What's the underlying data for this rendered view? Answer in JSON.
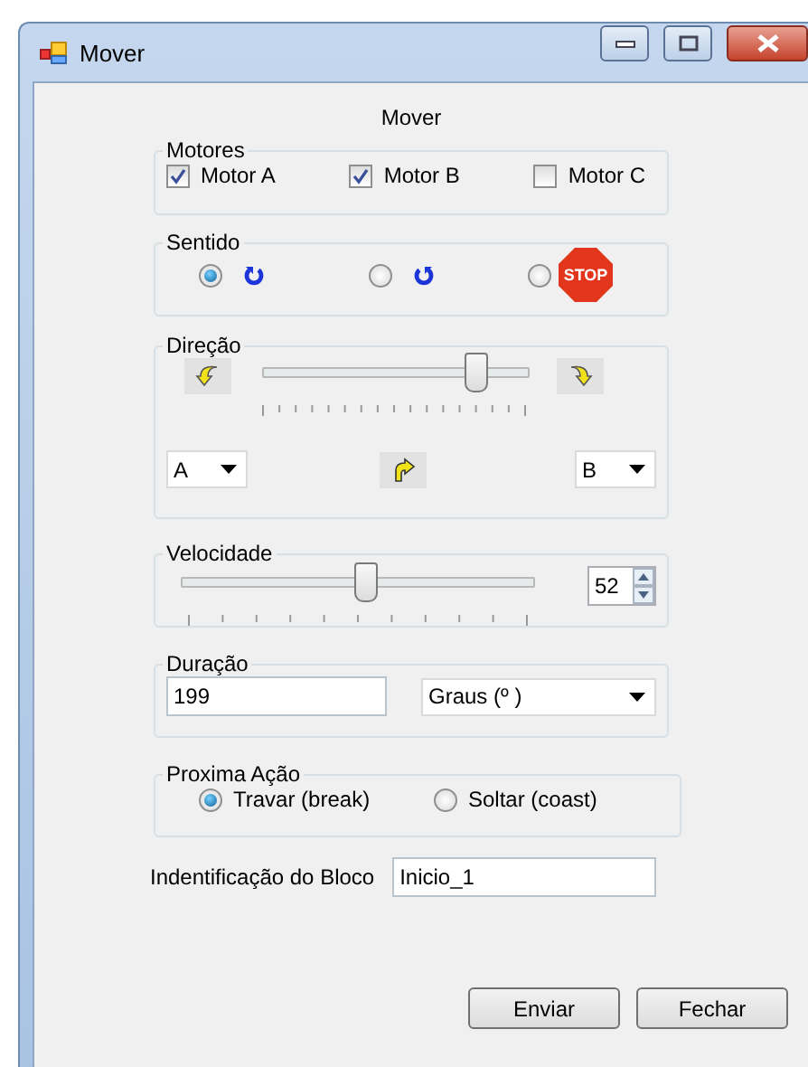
{
  "window": {
    "title": "Mover"
  },
  "heading": "Mover",
  "motores": {
    "label": "Motores",
    "items": [
      {
        "label": "Motor A",
        "checked": true
      },
      {
        "label": "Motor B",
        "checked": true
      },
      {
        "label": "Motor C",
        "checked": false
      }
    ]
  },
  "sentido": {
    "label": "Sentido",
    "options": [
      {
        "kind": "clockwise",
        "selected": true
      },
      {
        "kind": "counterclockwise",
        "selected": false
      },
      {
        "kind": "stop",
        "selected": false,
        "sign": "STOP"
      }
    ]
  },
  "direcao": {
    "label": "Direção",
    "level": 0.8,
    "left_motor": "A",
    "right_motor": "B"
  },
  "velocidade": {
    "label": "Velocidade",
    "level": 0.52,
    "value": "52"
  },
  "duracao": {
    "label": "Duração",
    "value": "199",
    "unit": "Graus (º )"
  },
  "proxima_acao": {
    "label": "Proxima Ação",
    "options": [
      {
        "label": "Travar (break)",
        "selected": true
      },
      {
        "label": "Soltar (coast)",
        "selected": false
      }
    ]
  },
  "identificacao": {
    "label": "Indentificação do Bloco",
    "value": "Inicio_1"
  },
  "buttons": [
    "Enviar",
    "Fechar"
  ]
}
